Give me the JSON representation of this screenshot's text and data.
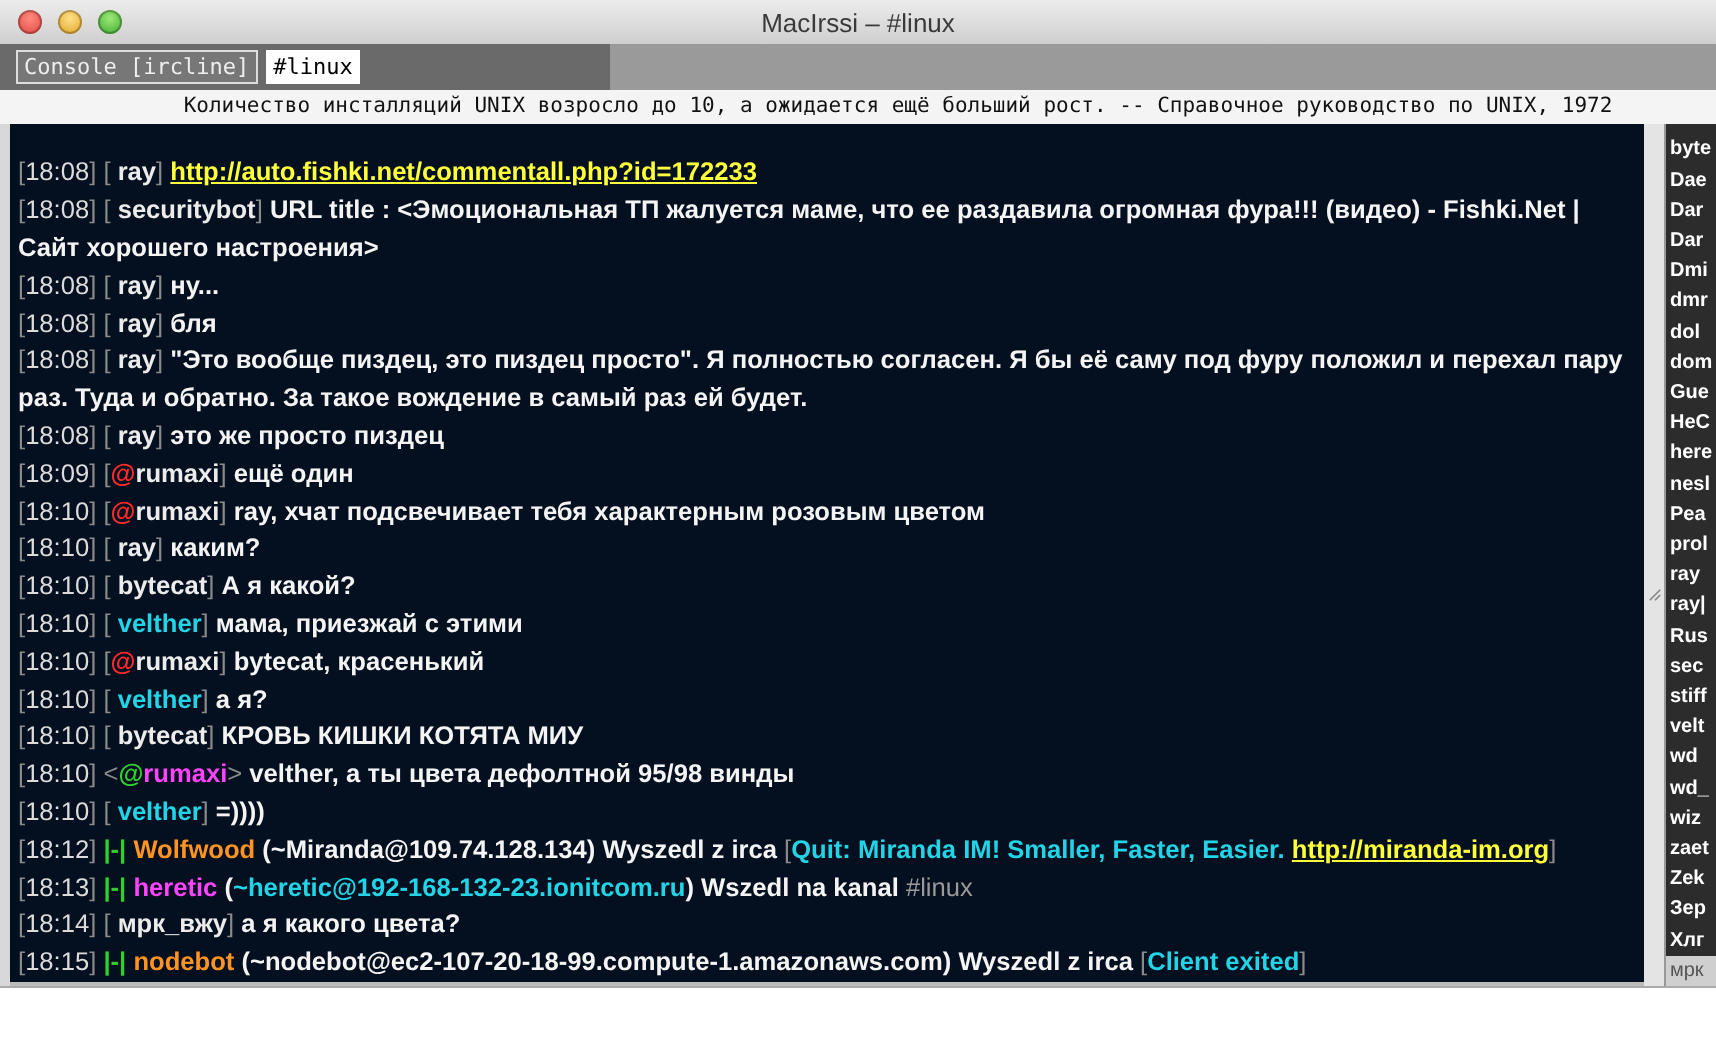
{
  "window": {
    "title": "MacIrssi – #linux"
  },
  "tabs": [
    {
      "label": "Console [ircline]",
      "selected": false
    },
    {
      "label": "#linux",
      "selected": true
    }
  ],
  "topic": "Количество инсталляций UNIX возросло до 10, а ожидается ещё больший рост. -- Справочное руководство по UNIX, 1972",
  "lines": [
    [
      {
        "kind": "punct",
        "text": "["
      },
      {
        "kind": "time",
        "text": "18:08"
      },
      {
        "kind": "punct",
        "text": "] [ "
      },
      {
        "kind": "nick",
        "text": "ray"
      },
      {
        "kind": "punct",
        "text": "] "
      },
      {
        "kind": "link",
        "text": "http://auto.fishki.net/commentall.php?id=172233"
      }
    ],
    [
      {
        "kind": "punct",
        "text": "["
      },
      {
        "kind": "time",
        "text": "18:08"
      },
      {
        "kind": "punct",
        "text": "] [ "
      },
      {
        "kind": "nick",
        "text": "securitybot"
      },
      {
        "kind": "punct",
        "text": "] "
      },
      {
        "kind": "text",
        "text": "URL title : <Эмоциональная ТП жалуется маме, что ее раздавила огромная фура!!! (видео) - Fishki.Net | Сайт хорошего настроения>"
      }
    ],
    [
      {
        "kind": "punct",
        "text": "["
      },
      {
        "kind": "time",
        "text": "18:08"
      },
      {
        "kind": "punct",
        "text": "] [ "
      },
      {
        "kind": "nick",
        "text": "ray"
      },
      {
        "kind": "punct",
        "text": "] "
      },
      {
        "kind": "text",
        "text": "ну..."
      }
    ],
    [
      {
        "kind": "punct",
        "text": "["
      },
      {
        "kind": "time",
        "text": "18:08"
      },
      {
        "kind": "punct",
        "text": "] [ "
      },
      {
        "kind": "nick",
        "text": "ray"
      },
      {
        "kind": "punct",
        "text": "] "
      },
      {
        "kind": "text",
        "text": "бля"
      }
    ],
    [
      {
        "kind": "punct",
        "text": "["
      },
      {
        "kind": "time",
        "text": "18:08"
      },
      {
        "kind": "punct",
        "text": "] [ "
      },
      {
        "kind": "nick",
        "text": "ray"
      },
      {
        "kind": "punct",
        "text": "] "
      },
      {
        "kind": "text",
        "text": "\"Это вообще пиздец, это пиздец просто\". Я полностью согласен. Я бы её саму под фуру положил и перехал пару раз. Туда и обратно. За такое вождение в самый раз ей будет."
      }
    ],
    [
      {
        "kind": "punct",
        "text": "["
      },
      {
        "kind": "time",
        "text": "18:08"
      },
      {
        "kind": "punct",
        "text": "] [ "
      },
      {
        "kind": "nick",
        "text": "ray"
      },
      {
        "kind": "punct",
        "text": "] "
      },
      {
        "kind": "text",
        "text": "это же просто пиздец"
      }
    ],
    [
      {
        "kind": "punct",
        "text": "["
      },
      {
        "kind": "time",
        "text": "18:09"
      },
      {
        "kind": "punct",
        "text": "] ["
      },
      {
        "kind": "op",
        "text": "@"
      },
      {
        "kind": "nick",
        "text": "rumaxi"
      },
      {
        "kind": "punct",
        "text": "] "
      },
      {
        "kind": "text",
        "text": "ещё один"
      }
    ],
    [
      {
        "kind": "punct",
        "text": "["
      },
      {
        "kind": "time",
        "text": "18:10"
      },
      {
        "kind": "punct",
        "text": "] ["
      },
      {
        "kind": "op",
        "text": "@"
      },
      {
        "kind": "nick",
        "text": "rumaxi"
      },
      {
        "kind": "punct",
        "text": "] "
      },
      {
        "kind": "text",
        "text": "ray, хчат подсвечивает тебя характерным розовым цветом"
      }
    ],
    [
      {
        "kind": "punct",
        "text": "["
      },
      {
        "kind": "time",
        "text": "18:10"
      },
      {
        "kind": "punct",
        "text": "] [ "
      },
      {
        "kind": "nick",
        "text": "ray"
      },
      {
        "kind": "punct",
        "text": "] "
      },
      {
        "kind": "text",
        "text": "каким?"
      }
    ],
    [
      {
        "kind": "punct",
        "text": "["
      },
      {
        "kind": "time",
        "text": "18:10"
      },
      {
        "kind": "punct",
        "text": "] [ "
      },
      {
        "kind": "nick",
        "text": "bytecat"
      },
      {
        "kind": "punct",
        "text": "] "
      },
      {
        "kind": "text",
        "text": "А я какой?"
      }
    ],
    [
      {
        "kind": "punct",
        "text": "["
      },
      {
        "kind": "time",
        "text": "18:10"
      },
      {
        "kind": "punct",
        "text": "] [ "
      },
      {
        "kind": "nick-cyan",
        "text": "velther"
      },
      {
        "kind": "punct",
        "text": "] "
      },
      {
        "kind": "text",
        "text": "мама, приезжай с этими"
      }
    ],
    [
      {
        "kind": "punct",
        "text": "["
      },
      {
        "kind": "time",
        "text": "18:10"
      },
      {
        "kind": "punct",
        "text": "] ["
      },
      {
        "kind": "op",
        "text": "@"
      },
      {
        "kind": "nick",
        "text": "rumaxi"
      },
      {
        "kind": "punct",
        "text": "] "
      },
      {
        "kind": "text",
        "text": "bytecat, красенький"
      }
    ],
    [
      {
        "kind": "punct",
        "text": "["
      },
      {
        "kind": "time",
        "text": "18:10"
      },
      {
        "kind": "punct",
        "text": "] [ "
      },
      {
        "kind": "nick-cyan",
        "text": "velther"
      },
      {
        "kind": "punct",
        "text": "] "
      },
      {
        "kind": "text",
        "text": "а я?"
      }
    ],
    [
      {
        "kind": "punct",
        "text": "["
      },
      {
        "kind": "time",
        "text": "18:10"
      },
      {
        "kind": "punct",
        "text": "] [ "
      },
      {
        "kind": "nick",
        "text": "bytecat"
      },
      {
        "kind": "punct",
        "text": "] "
      },
      {
        "kind": "text",
        "text": "КРОВЬ КИШКИ КОТЯТА МИУ"
      }
    ],
    [
      {
        "kind": "punct",
        "text": "["
      },
      {
        "kind": "time",
        "text": "18:10"
      },
      {
        "kind": "punct",
        "text": "] <"
      },
      {
        "kind": "op-own",
        "text": "@"
      },
      {
        "kind": "nick-pink",
        "text": "rumaxi"
      },
      {
        "kind": "punct",
        "text": "> "
      },
      {
        "kind": "text",
        "text": "velther, а ты цвета дефолтной 95/98 винды"
      }
    ],
    [
      {
        "kind": "punct",
        "text": "["
      },
      {
        "kind": "time",
        "text": "18:10"
      },
      {
        "kind": "punct",
        "text": "] [ "
      },
      {
        "kind": "nick-cyan",
        "text": "velther"
      },
      {
        "kind": "punct",
        "text": "] "
      },
      {
        "kind": "text",
        "text": "=))))"
      }
    ],
    [
      {
        "kind": "punct",
        "text": "["
      },
      {
        "kind": "time",
        "text": "18:12"
      },
      {
        "kind": "punct",
        "text": "] "
      },
      {
        "kind": "join",
        "text": "|-|"
      },
      {
        "kind": "nick-orange",
        "text": " Wolfwood"
      },
      {
        "kind": "text",
        "text": " (~Miranda@109.74.128.134) Wyszedl z irca "
      },
      {
        "kind": "punct",
        "text": "["
      },
      {
        "kind": "notice-bold",
        "text": "Quit: Miranda IM!"
      },
      {
        "kind": "notice",
        "text": " Smaller, Faster, Easier. "
      },
      {
        "kind": "link",
        "text": "http://miranda-im.org"
      },
      {
        "kind": "punct",
        "text": "]"
      }
    ],
    [
      {
        "kind": "punct",
        "text": "["
      },
      {
        "kind": "time",
        "text": "18:13"
      },
      {
        "kind": "punct",
        "text": "] "
      },
      {
        "kind": "join",
        "text": "|-|"
      },
      {
        "kind": "nick-pink",
        "text": " heretic"
      },
      {
        "kind": "text",
        "text": " ("
      },
      {
        "kind": "notice",
        "text": "~heretic@192-168-132-23.ionitcom.ru"
      },
      {
        "kind": "text",
        "text": ") Wszedl na kanal "
      },
      {
        "kind": "channel",
        "text": "#linux"
      }
    ],
    [
      {
        "kind": "punct",
        "text": "["
      },
      {
        "kind": "time",
        "text": "18:14"
      },
      {
        "kind": "punct",
        "text": "] [ "
      },
      {
        "kind": "nick",
        "text": "мрк_вжу"
      },
      {
        "kind": "punct",
        "text": "] "
      },
      {
        "kind": "text",
        "text": "а я какого цвета?"
      }
    ],
    [
      {
        "kind": "punct",
        "text": "["
      },
      {
        "kind": "time",
        "text": "18:15"
      },
      {
        "kind": "punct",
        "text": "] "
      },
      {
        "kind": "join",
        "text": "|-|"
      },
      {
        "kind": "nick-orange",
        "text": " nodebot"
      },
      {
        "kind": "text",
        "text": " (~nodebot@ec2-107-20-18-99.compute-1.amazonaws.com) Wyszedl z irca "
      },
      {
        "kind": "punct",
        "text": "["
      },
      {
        "kind": "notice",
        "text": "Client exited"
      },
      {
        "kind": "punct",
        "text": "]"
      }
    ]
  ],
  "nicklist": [
    {
      "name": "byte",
      "selected": false
    },
    {
      "name": "Dae",
      "selected": false
    },
    {
      "name": "Dar",
      "selected": false
    },
    {
      "name": "Dar",
      "selected": false
    },
    {
      "name": "Dmi",
      "selected": false
    },
    {
      "name": "dmr",
      "selected": false
    },
    {
      "name": "dol",
      "selected": false
    },
    {
      "name": "dom",
      "selected": false
    },
    {
      "name": "Gue",
      "selected": false
    },
    {
      "name": "HeC",
      "selected": false
    },
    {
      "name": "here",
      "selected": false
    },
    {
      "name": "nesl",
      "selected": false
    },
    {
      "name": "Pea",
      "selected": false
    },
    {
      "name": "prol",
      "selected": false
    },
    {
      "name": "ray",
      "selected": false
    },
    {
      "name": "ray|",
      "selected": false
    },
    {
      "name": "Rus",
      "selected": false
    },
    {
      "name": "sec",
      "selected": false
    },
    {
      "name": "stiff",
      "selected": false
    },
    {
      "name": "velt",
      "selected": false
    },
    {
      "name": "wd",
      "selected": false
    },
    {
      "name": "wd_",
      "selected": false
    },
    {
      "name": "wiz",
      "selected": false
    },
    {
      "name": "zaet",
      "selected": false
    },
    {
      "name": "Zek",
      "selected": false
    },
    {
      "name": "Зер",
      "selected": false
    },
    {
      "name": "Хлг",
      "selected": false
    },
    {
      "name": "мрк",
      "selected": true
    }
  ]
}
